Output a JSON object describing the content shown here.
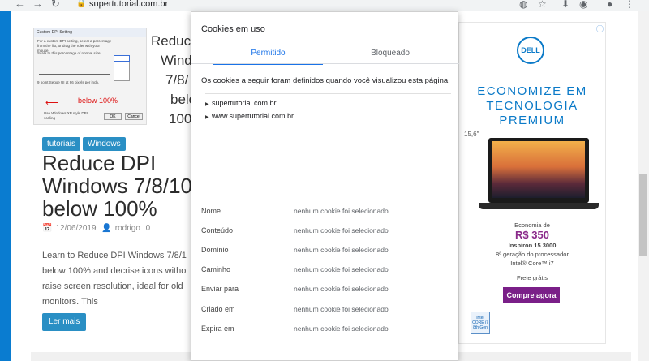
{
  "browser": {
    "url": "supertutorial.com.br"
  },
  "thumbnail": {
    "dialog_title": "Custom DPI Setting",
    "dialog_text": "For a custom DPI setting, select a percentage from the list, or drag the ruler with your mouse.",
    "scale_label": "Scale to this percentage of normal size:",
    "font_sample": "9 point Segoe UI at 96 pixels per inch.",
    "below_label": "below 100%",
    "checkbox_label": "Use Windows XP style DPI scaling",
    "ok": "OK",
    "cancel": "Cancel"
  },
  "teaser_lines": [
    "Reduc",
    "Windo",
    "7/8/",
    "belo",
    "100"
  ],
  "tags": [
    "tutoriais",
    "Windows"
  ],
  "post": {
    "title": "Reduce DPI Windows 7/8/10 below 100%",
    "date": "12/06/2019",
    "author": "rodrigo",
    "comments": "0",
    "excerpt_lines": [
      "Learn to Reduce DPI Windows 7/8/1",
      "below 100% and decrise icons witho",
      "raise screen resolution, ideal for old",
      "monitors. This"
    ],
    "read_more": "Ler mais"
  },
  "ad": {
    "brand": "DELL",
    "headline": [
      "ECONOMIZE EM",
      "TECNOLOGIA",
      "PREMIUM"
    ],
    "size": "15,6\"",
    "economia": "Economia de",
    "price": "R$ 350",
    "model": "Inspiron 15 3000",
    "processor_line1": "8ª geração do processador",
    "processor_line2": "Intel® Core™ i7",
    "shipping": "Frete grátis",
    "cta": "Compre agora",
    "intel_badge": "intel CORE i7 8th Gen"
  },
  "cookies_popup": {
    "title": "Cookies em uso",
    "tabs": [
      "Permitido",
      "Bloqueado"
    ],
    "description": "Os cookies a seguir foram definidos quando você visualizou esta página",
    "domains": [
      "supertutorial.com.br",
      "www.supertutorial.com.br"
    ],
    "fields": [
      {
        "label": "Nome",
        "value": "nenhum cookie foi selecionado"
      },
      {
        "label": "Conteúdo",
        "value": "nenhum cookie foi selecionado"
      },
      {
        "label": "Domínio",
        "value": "nenhum cookie foi selecionado"
      },
      {
        "label": "Caminho",
        "value": "nenhum cookie foi selecionado"
      },
      {
        "label": "Enviar para",
        "value": "nenhum cookie foi selecionado"
      },
      {
        "label": "Criado em",
        "value": "nenhum cookie foi selecionado"
      },
      {
        "label": "Expira em",
        "value": "nenhum cookie foi selecionado"
      }
    ]
  },
  "colors": {
    "accent_blue": "#1a73e8",
    "tag_blue": "#2a8fc4",
    "dell_blue": "#0b7ac8",
    "cta_purple": "#7a1f88",
    "desktop_blue": "#0a7cd0"
  }
}
